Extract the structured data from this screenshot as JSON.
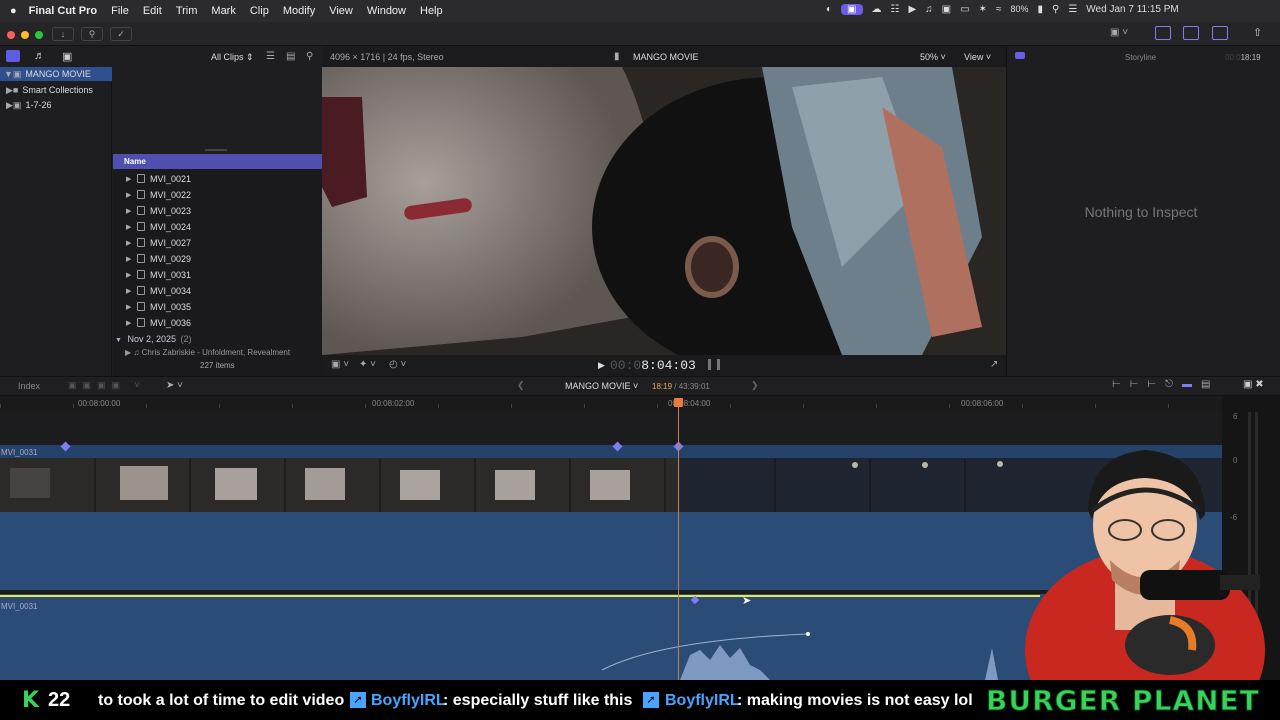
{
  "menubar": {
    "app": "Final Cut Pro",
    "items": [
      "File",
      "Edit",
      "Trim",
      "Mark",
      "Clip",
      "Modify",
      "View",
      "Window",
      "Help"
    ],
    "battery": "80%",
    "datetime": "Wed Jan 7  11:15 PM"
  },
  "browser": {
    "filter": "All Clips",
    "library": "MANGO MOVIE",
    "smart_collections": "Smart Collections",
    "event": "1-7-26",
    "column_name": "Name",
    "clips": [
      "MVI_0021",
      "MVI_0022",
      "MVI_0023",
      "MVI_0024",
      "MVI_0027",
      "MVI_0029",
      "MVI_0031",
      "MVI_0034",
      "MVI_0035",
      "MVI_0036"
    ],
    "group_label": "Nov 2, 2025",
    "group_count": "(2)",
    "truncated_item": "Chris Zabriskie - Unfoldment, Revealment",
    "item_count": "227 items"
  },
  "viewer": {
    "format": "4096 × 1716 | 24 fps, Stereo",
    "title": "MANGO MOVIE",
    "zoom": "50%",
    "view_label": "View",
    "timecode_dim": "00:0",
    "timecode": "8:04:03"
  },
  "inspector": {
    "label": "Storyline",
    "dur_dim": "00:0",
    "duration": "18:19",
    "empty_message": "Nothing to Inspect"
  },
  "timeline": {
    "index_label": "Index",
    "project": "MANGO MOVIE",
    "position": "18:19",
    "total": "43:39:01",
    "ruler": [
      "00:08:00:00",
      "00:08:02:00",
      "00:08:04:00",
      "00:08:06:00"
    ],
    "clip_label": "MVI_0031",
    "audio_clip_label": "MVI_0031",
    "meter_labels": [
      "6",
      "0",
      "-6"
    ]
  },
  "ticker": {
    "count": "22",
    "msg1": "to took a lot of time to edit video",
    "user": "BoyflyIRL",
    "msg2": ": especially stuff like this",
    "user2": "BoyflyIRL",
    "msg3": ": making movies is not easy lol",
    "brand": "BURGER PLANET"
  },
  "colors": {
    "accent": "#5e5ce6",
    "playhead": "#f5a623",
    "audio_line": "#e8e84a",
    "brand_green": "#37d35a",
    "chat_user": "#4aa3ff"
  }
}
